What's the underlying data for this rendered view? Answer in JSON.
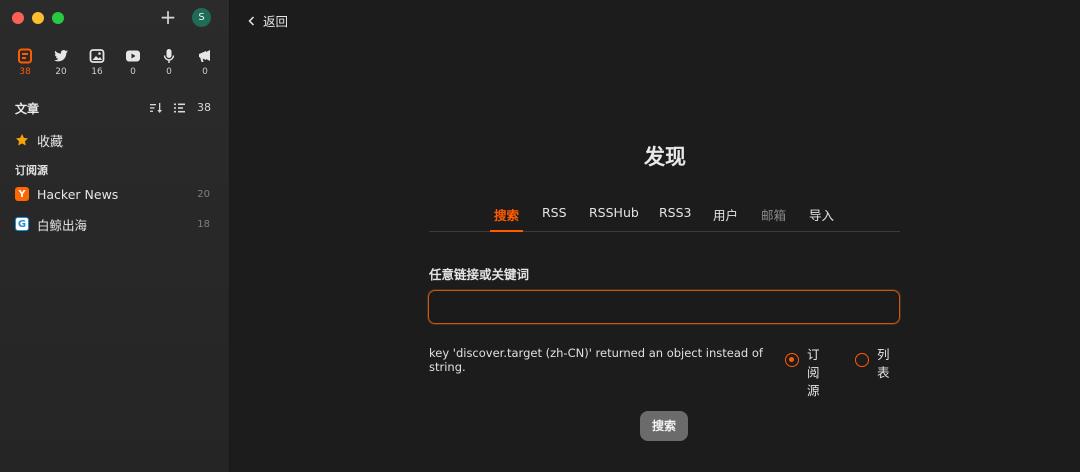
{
  "window": {
    "controls": [
      "close",
      "minimize",
      "zoom"
    ]
  },
  "sidebar": {
    "add_icon": "plus-icon",
    "avatar_letter": "S",
    "views": [
      {
        "icon": "article-icon",
        "count": "38",
        "active": true
      },
      {
        "icon": "twitter-icon",
        "count": "20"
      },
      {
        "icon": "image-icon",
        "count": "16"
      },
      {
        "icon": "video-icon",
        "count": "0"
      },
      {
        "icon": "microphone-icon",
        "count": "0"
      },
      {
        "icon": "megaphone-icon",
        "count": "0"
      }
    ],
    "section_title": "文章",
    "section_count": "38",
    "favorites_label": "收藏",
    "subscriptions_label": "订阅源",
    "feeds": [
      {
        "icon_letter": "Y",
        "icon_color": "#ff6600",
        "name": "Hacker News",
        "count": "20"
      },
      {
        "icon_letter": "G",
        "icon_color": "#1a8fe0",
        "name": "白鲸出海",
        "count": "18"
      }
    ]
  },
  "main": {
    "back_label": "返回",
    "title": "发现",
    "tabs": [
      {
        "label": "搜索",
        "state": "active"
      },
      {
        "label": "RSS"
      },
      {
        "label": "RSSHub"
      },
      {
        "label": "RSS3"
      },
      {
        "label": "用户"
      },
      {
        "label": "邮箱",
        "state": "disabled"
      },
      {
        "label": "导入"
      }
    ],
    "field_label": "任意链接或关键词",
    "input_value": "",
    "error_message": "key 'discover.target (zh-CN)' returned an object instead of string.",
    "radio_options": [
      {
        "label": "订阅源",
        "selected": true
      },
      {
        "label": "列表",
        "selected": false
      }
    ],
    "search_button": "搜索"
  },
  "colors": {
    "accent": "#ff5c00",
    "sidebar_bg": "#2b2b2b",
    "main_bg": "#1c1c1c"
  }
}
